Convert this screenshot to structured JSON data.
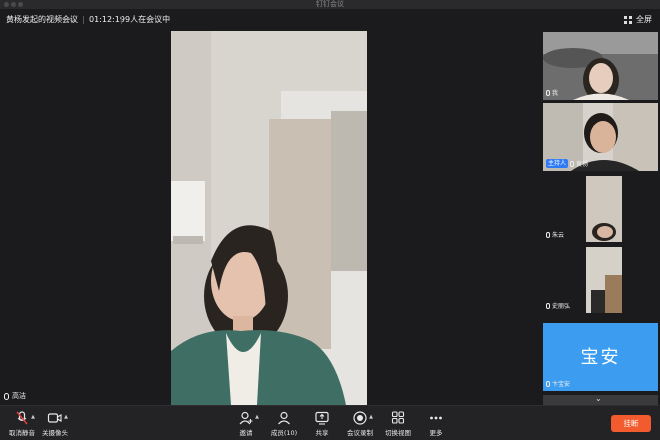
{
  "window": {
    "title": "钉钉会议"
  },
  "header": {
    "meeting_title": "黄杨发起的视频会议",
    "elapsed_time": "01:12:19",
    "participants_in_meeting": "9人在会议中",
    "fullscreen_label": "全屏"
  },
  "main": {
    "speaker_name": "高洁"
  },
  "participants": [
    {
      "name": "我",
      "host": false,
      "badge": ""
    },
    {
      "name": "黄杨",
      "host": true,
      "badge": "主持人"
    },
    {
      "name": "朱云",
      "host": false,
      "badge": ""
    },
    {
      "name": "史丽弘",
      "host": false,
      "badge": ""
    },
    {
      "name": "卞宝安",
      "host": false,
      "badge": "",
      "avatar_text": "宝安",
      "avatar_color": "#3b9cf0"
    }
  ],
  "toolbar": {
    "unmute_label": "取消静音",
    "camera_label": "关摄像头",
    "invite_label": "邀请",
    "members_label": "成员(10)",
    "share_label": "共享",
    "record_label": "会议录制",
    "switch_view_label": "切换视图",
    "more_label": "更多",
    "leave_label": "挂断"
  },
  "colors": {
    "accent": "#2f7bf6",
    "leave": "#f25b2d",
    "mute_red": "#e5443a"
  }
}
